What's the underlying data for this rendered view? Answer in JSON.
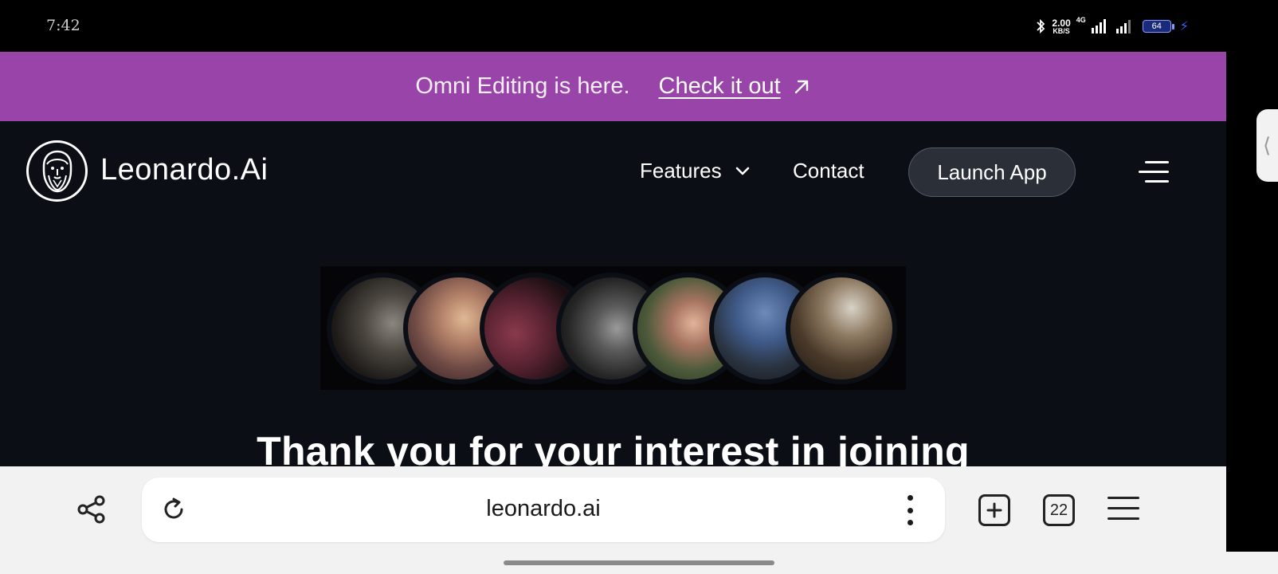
{
  "status_bar": {
    "time": "7:42",
    "net_speed_value": "2.00",
    "net_speed_unit": "KB/S",
    "network_tag": "4G",
    "battery_level": "64",
    "icons": [
      "bluetooth-icon",
      "signal-icon",
      "signal-icon",
      "battery-icon",
      "charging-icon"
    ]
  },
  "promo_banner": {
    "text": "Omni Editing is here.",
    "link_label": "Check it out",
    "background": "#9944a8"
  },
  "nav": {
    "brand": "Leonardo.Ai",
    "features_label": "Features",
    "contact_label": "Contact",
    "launch_label": "Launch App"
  },
  "hero": {
    "avatar_gallery": [
      {
        "name": "tattooed-man-portrait"
      },
      {
        "name": "blonde-woman-portrait"
      },
      {
        "name": "gold-headband-portrait"
      },
      {
        "name": "bearded-man-sunglasses-portrait"
      },
      {
        "name": "young-woman-portrait"
      },
      {
        "name": "man-saluting-portrait"
      },
      {
        "name": "elderly-man-portrait"
      }
    ],
    "headline": "Thank you for your interest in joining"
  },
  "browser": {
    "url": "leonardo.ai",
    "tab_count": "22"
  },
  "colors": {
    "page_background": "#0b0e15",
    "promo_background": "#9944a8",
    "launch_button": "#2b2f38",
    "toolbar_background": "#f2f2f2"
  }
}
